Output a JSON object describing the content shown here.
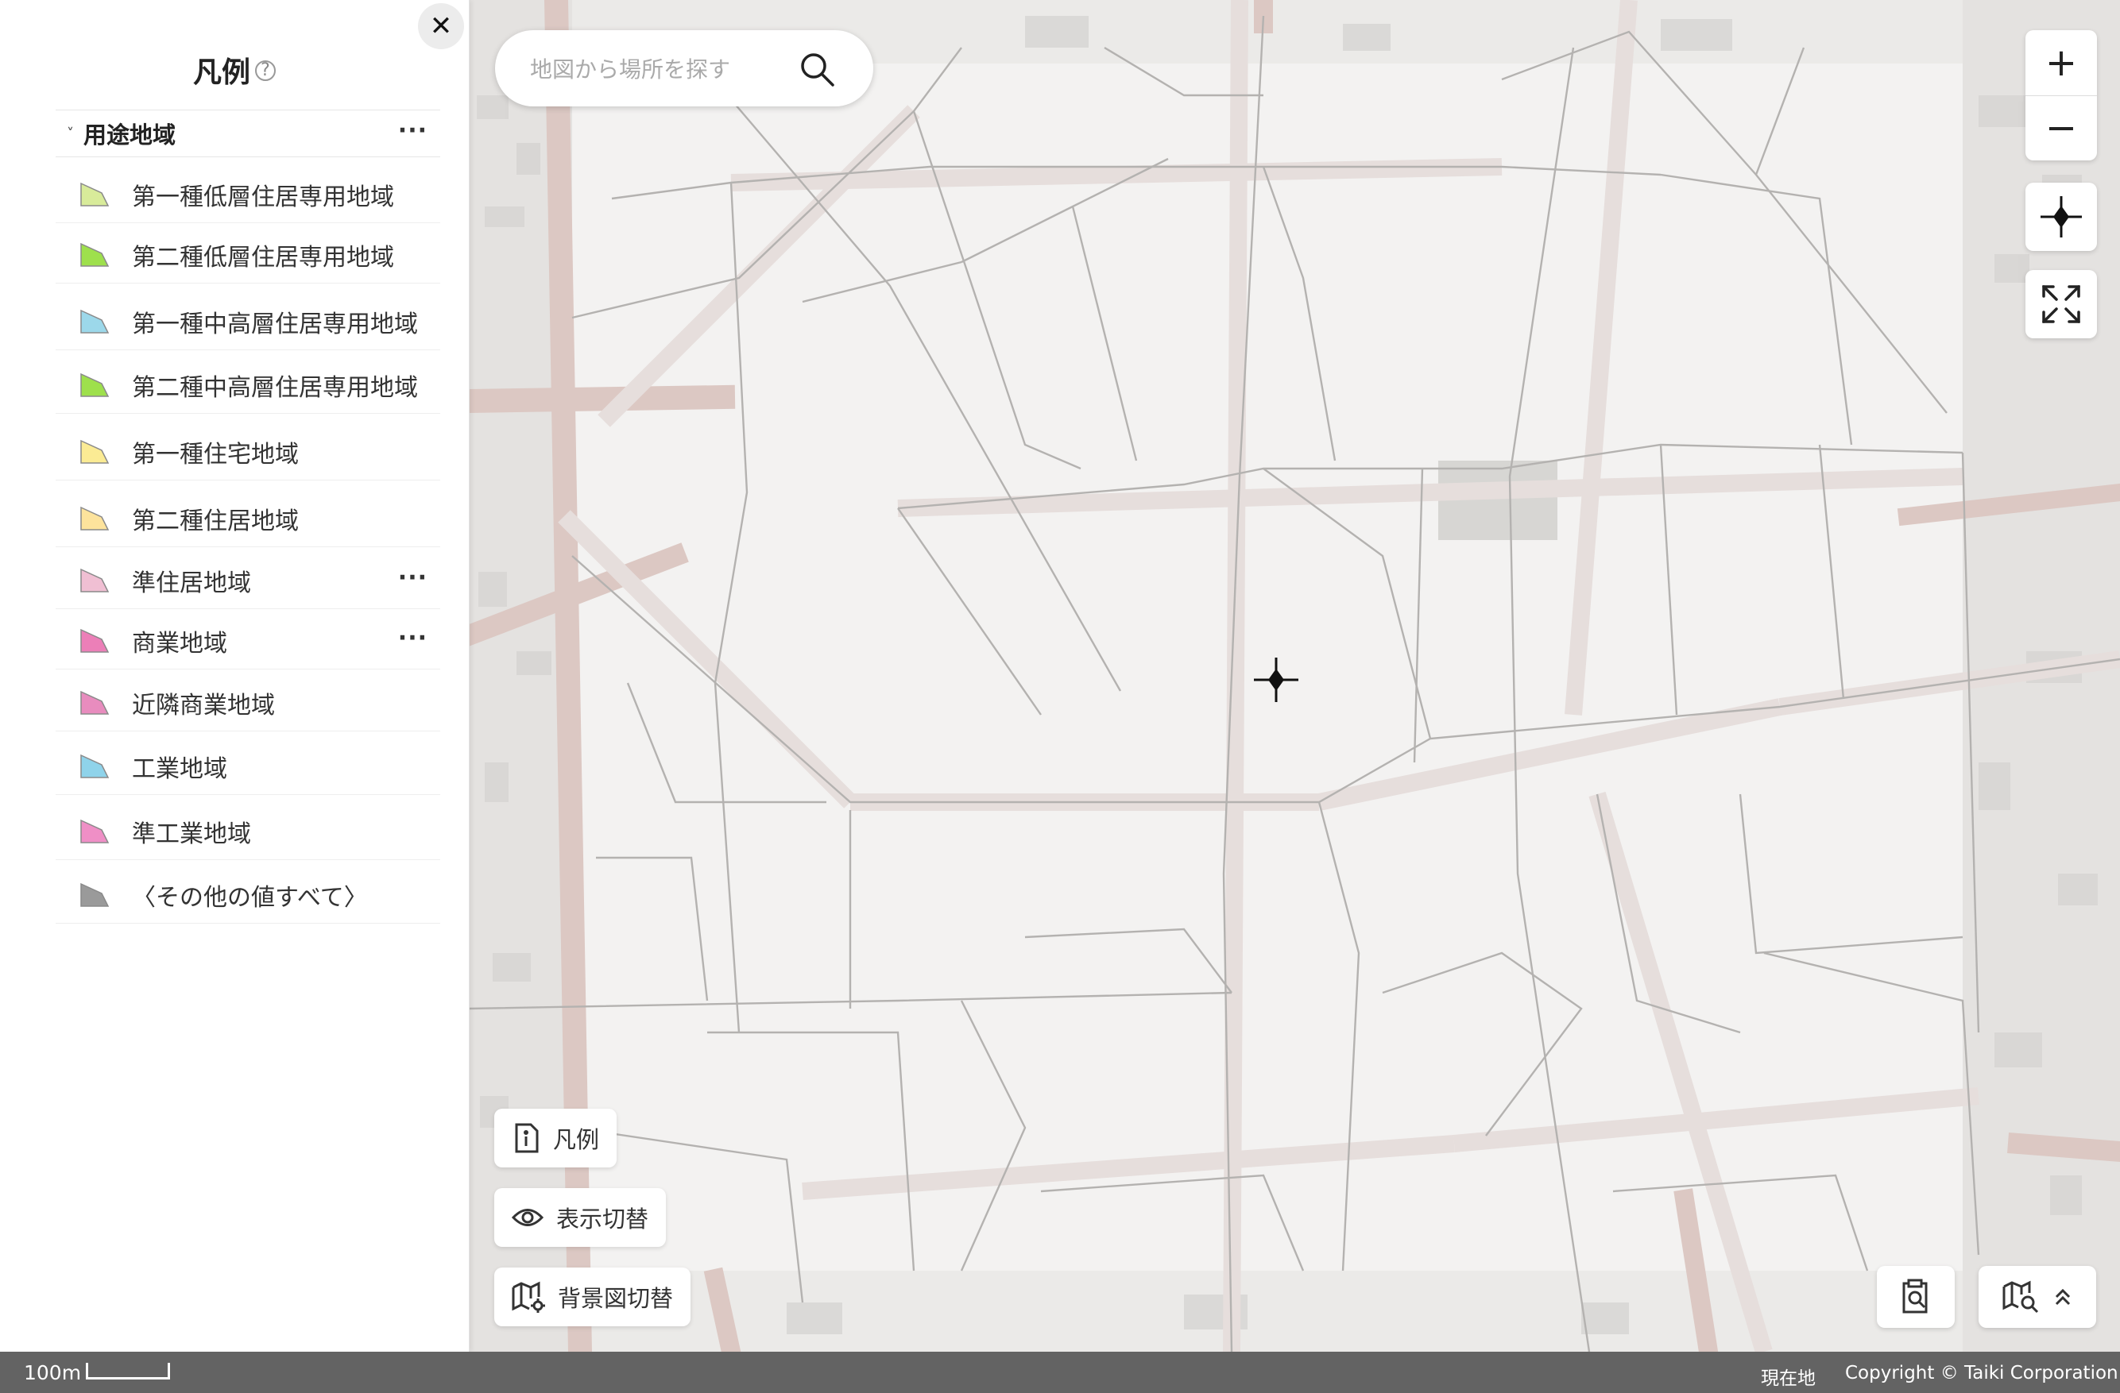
{
  "legend": {
    "title": "凡例",
    "help_icon": "question-circle-icon",
    "close_icon": "close-icon",
    "close_glyph": "✕",
    "group": {
      "label": "用途地域",
      "expanded": true,
      "chevron_glyph": "˅",
      "more_glyph": "···"
    },
    "items": [
      {
        "label": "第一種低層住居専用地域",
        "color": "#d8eb9a",
        "has_menu": false
      },
      {
        "label": "第二種低層住居専用地域",
        "color": "#9ee04c",
        "has_menu": false
      },
      {
        "label": "第一種中高層住居専用地域",
        "color": "#9cd8ea",
        "has_menu": false
      },
      {
        "label": "第二種中高層住居専用地域",
        "color": "#9ee04c",
        "has_menu": false
      },
      {
        "label": "第一種住宅地域",
        "color": "#fbeb94",
        "has_menu": false
      },
      {
        "label": "第二種住居地域",
        "color": "#fde39c",
        "has_menu": false
      },
      {
        "label": "準住居地域",
        "color": "#f0bfd3",
        "has_menu": true
      },
      {
        "label": "商業地域",
        "color": "#ec7fb8",
        "has_menu": true
      },
      {
        "label": "近隣商業地域",
        "color": "#e88cbe",
        "has_menu": false
      },
      {
        "label": "工業地域",
        "color": "#8fd3ea",
        "has_menu": false
      },
      {
        "label": "準工業地域",
        "color": "#ef8fc6",
        "has_menu": false
      },
      {
        "label": "〈その他の値すべて〉",
        "color": "#9a9a9a",
        "has_menu": false
      }
    ],
    "more_glyph": "···"
  },
  "search": {
    "placeholder": "地図から場所を探す",
    "icon": "search-icon"
  },
  "controls": {
    "zoom_in": "+",
    "zoom_out": "−",
    "locate_icon": "crosshair-icon",
    "fullscreen_icon": "expand-icon"
  },
  "buttons": {
    "legend": {
      "label": "凡例",
      "icon": "document-info-icon"
    },
    "toggle": {
      "label": "表示切替",
      "icon": "eye-icon"
    },
    "basemap": {
      "label": "背景図切替",
      "icon": "map-gear-icon"
    },
    "report_icon": "clipboard-search-icon",
    "map_search_icon": "map-search-icon",
    "expand_icon": "chevron-double-up-icon"
  },
  "statusbar": {
    "scale": "100m",
    "location": "現在地",
    "copyright": "Copyright © Taiki Corporation."
  },
  "colors": {
    "road": "#d9c7c2",
    "parcel_line": "#aaaaaa",
    "map_bg": "#f3f2f1"
  }
}
